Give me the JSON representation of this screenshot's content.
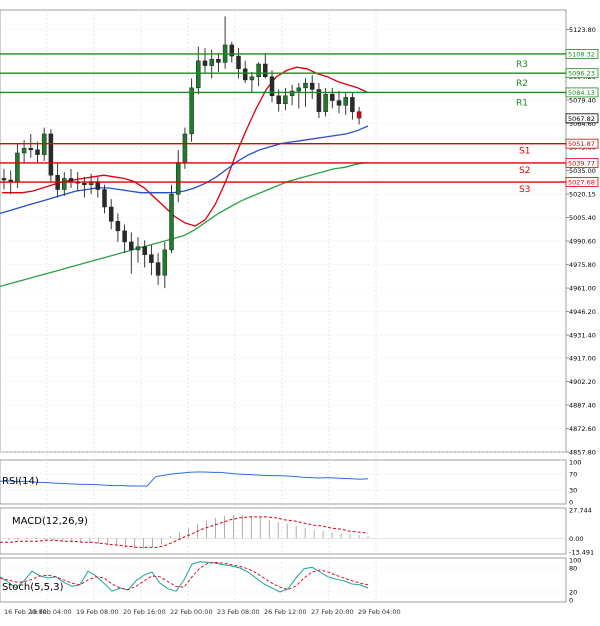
{
  "chart_data": [
    {
      "type": "candlestick",
      "panel": "price",
      "ylim": [
        4857.8,
        5136.0
      ],
      "y_ticks": [
        "5123.80",
        "5108.30",
        "5094.20",
        "5079.40",
        "5064.60",
        "5049.80",
        "5035.00",
        "5020.15",
        "5005.40",
        "4990.60",
        "4975.80",
        "4961.00",
        "4946.20",
        "4931.40",
        "4917.00",
        "4902.20",
        "4887.40",
        "4872.60",
        "4857.80"
      ],
      "x_ticks": [
        "16 Feb 20:00",
        "16 Feb 04:00",
        "19 Feb 08:00",
        "20 Feb 16:00",
        "22 Feb 00:00",
        "23 Feb 08:00",
        "26 Feb 12:00",
        "27 Feb 20:00",
        "29 Feb 04:00"
      ],
      "candles": [
        [
          5030,
          5036,
          5023,
          5029
        ],
        [
          5029,
          5035,
          5020,
          5028
        ],
        [
          5028,
          5052,
          5024,
          5046
        ],
        [
          5046,
          5054,
          5040,
          5049
        ],
        [
          5049,
          5058,
          5043,
          5048
        ],
        [
          5048,
          5053,
          5040,
          5045
        ],
        [
          5045,
          5062,
          5041,
          5058
        ],
        [
          5058,
          5061,
          5028,
          5032
        ],
        [
          5032,
          5040,
          5018,
          5023
        ],
        [
          5023,
          5034,
          5019,
          5030
        ],
        [
          5030,
          5036,
          5024,
          5028
        ],
        [
          5028,
          5034,
          5022,
          5027
        ],
        [
          5027,
          5031,
          5018,
          5026
        ],
        [
          5026,
          5033,
          5020,
          5028
        ],
        [
          5028,
          5031,
          5018,
          5023
        ],
        [
          5023,
          5026,
          5008,
          5012
        ],
        [
          5012,
          5017,
          4998,
          5003
        ],
        [
          5003,
          5008,
          4990,
          4997
        ],
        [
          4997,
          5001,
          4983,
          4990
        ],
        [
          4990,
          4996,
          4970,
          4985
        ],
        [
          4985,
          4993,
          4977,
          4987
        ],
        [
          4987,
          4991,
          4974,
          4982
        ],
        [
          4982,
          4988,
          4969,
          4977
        ],
        [
          4977,
          4983,
          4963,
          4969
        ],
        [
          4969,
          4990,
          4961,
          4985
        ],
        [
          4985,
          5026,
          4983,
          5020
        ],
        [
          5020,
          5048,
          5015,
          5040
        ],
        [
          5040,
          5062,
          5036,
          5058
        ],
        [
          5058,
          5093,
          5053,
          5087
        ],
        [
          5087,
          5113,
          5083,
          5104
        ],
        [
          5104,
          5112,
          5096,
          5101
        ],
        [
          5101,
          5111,
          5093,
          5105
        ],
        [
          5105,
          5109,
          5097,
          5103
        ],
        [
          5103,
          5132,
          5099,
          5114
        ],
        [
          5114,
          5116,
          5103,
          5107
        ],
        [
          5107,
          5112,
          5093,
          5099
        ],
        [
          5099,
          5104,
          5090,
          5092
        ],
        [
          5092,
          5097,
          5084,
          5094
        ],
        [
          5094,
          5103,
          5088,
          5102
        ],
        [
          5102,
          5109,
          5093,
          5094
        ],
        [
          5094,
          5098,
          5078,
          5082
        ],
        [
          5082,
          5086,
          5072,
          5077
        ],
        [
          5077,
          5087,
          5073,
          5082
        ],
        [
          5082,
          5089,
          5076,
          5085
        ],
        [
          5085,
          5090,
          5074,
          5087
        ],
        [
          5087,
          5093,
          5075,
          5090
        ],
        [
          5090,
          5095,
          5080,
          5086
        ],
        [
          5086,
          5090,
          5068,
          5072
        ],
        [
          5072,
          5087,
          5069,
          5083
        ],
        [
          5083,
          5087,
          5074,
          5079
        ],
        [
          5079,
          5085,
          5071,
          5076
        ],
        [
          5076,
          5084,
          5070,
          5081
        ],
        [
          5081,
          5084,
          5067,
          5072
        ],
        [
          5072,
          5075,
          5064,
          5068
        ]
      ],
      "moving_averages": [
        {
          "color": "#d9000d",
          "values": [
            5021,
            5021,
            5021,
            5022,
            5024,
            5026,
            5028,
            5029,
            5030,
            5031,
            5032,
            5031,
            5030,
            5028,
            5024,
            5018,
            5012,
            5006,
            5002,
            5000,
            5004,
            5014,
            5028,
            5045,
            5060,
            5074,
            5086,
            5094,
            5098,
            5100,
            5099,
            5096,
            5094,
            5091,
            5089,
            5087,
            5084
          ]
        },
        {
          "color": "#2450c8",
          "values": [
            5008,
            5010,
            5012,
            5014,
            5016,
            5018,
            5020,
            5022,
            5023,
            5024,
            5024,
            5023,
            5022,
            5021,
            5021,
            5021,
            5021,
            5022,
            5024,
            5027,
            5031,
            5036,
            5041,
            5045,
            5048,
            5050,
            5052,
            5053,
            5054,
            5055,
            5056,
            5057,
            5058,
            5060,
            5063
          ]
        },
        {
          "color": "#2aa044",
          "values": [
            4962,
            4964,
            4966,
            4968,
            4970,
            4972,
            4974,
            4976,
            4978,
            4980,
            4982,
            4984,
            4986,
            4988,
            4990,
            4992,
            4994,
            4998,
            5003,
            5008,
            5012,
            5016,
            5019,
            5022,
            5025,
            5028,
            5030,
            5032,
            5034,
            5036,
            5037,
            5039,
            5040
          ]
        }
      ],
      "levels": [
        {
          "name": "R3",
          "value": "5108.32",
          "color": "#1f8a1f"
        },
        {
          "name": "R2",
          "value": "5096.23",
          "color": "#1f8a1f"
        },
        {
          "name": "R1",
          "value": "5084.13",
          "color": "#1f8a1f"
        },
        {
          "name": "S1",
          "value": "5051.87",
          "color": "#e00000"
        },
        {
          "name": "S2",
          "value": "5039.77",
          "color": "#e00000"
        },
        {
          "name": "S3",
          "value": "5027.68",
          "color": "#e00000"
        }
      ],
      "current_price": "5067.82"
    },
    {
      "type": "line",
      "panel": "rsi",
      "title": "RSI(14)",
      "ylim": [
        0,
        100
      ],
      "y_ticks": [
        "100",
        "70",
        "30",
        "0"
      ],
      "values": [
        52,
        53,
        51,
        52,
        50,
        49,
        48,
        47,
        46,
        45,
        44,
        44,
        43,
        42,
        41,
        41,
        40,
        40,
        40,
        63,
        67,
        70,
        72,
        74,
        75,
        75,
        74,
        74,
        72,
        70,
        69,
        68,
        67,
        66,
        66,
        65,
        64,
        62,
        61,
        60,
        61,
        60,
        59,
        58,
        57,
        58
      ]
    },
    {
      "type": "line",
      "panel": "macd",
      "title": "MACD(12,26,9)",
      "ylim": [
        -13.491,
        27.744
      ],
      "y_ticks": [
        "27.744",
        "0.00",
        "-13.491"
      ],
      "histogram": [
        -3,
        -2,
        -2,
        -1,
        -1,
        -1,
        -2,
        -3,
        -4,
        -4,
        -5,
        -6,
        -7,
        -8,
        -9,
        -10,
        -10,
        -9,
        -6,
        2,
        6,
        10,
        14,
        17,
        20,
        22,
        23,
        23,
        22,
        20,
        18,
        16,
        14,
        12,
        10,
        8,
        7,
        6,
        5,
        4,
        3,
        2
      ],
      "signal": [
        -4,
        -4,
        -3,
        -3,
        -3,
        -2,
        -2,
        -3,
        -3,
        -4,
        -4,
        -5,
        -6,
        -7,
        -8,
        -9,
        -9,
        -9,
        -7,
        -3,
        1,
        5,
        9,
        12,
        15,
        18,
        20,
        21,
        21,
        21,
        20,
        18,
        17,
        15,
        13,
        12,
        10,
        9,
        7,
        6,
        5
      ]
    },
    {
      "type": "line",
      "panel": "stochastic",
      "title": "Stoch(5,5,3)",
      "ylim": [
        0,
        100
      ],
      "y_ticks": [
        "100",
        "80",
        "20",
        "0"
      ],
      "k": [
        58,
        45,
        30,
        48,
        72,
        60,
        55,
        58,
        44,
        34,
        38,
        72,
        60,
        42,
        22,
        30,
        25,
        48,
        62,
        70,
        42,
        28,
        22,
        50,
        90,
        96,
        94,
        92,
        88,
        85,
        80,
        70,
        55,
        40,
        30,
        20,
        28,
        55,
        78,
        82,
        70,
        58,
        52,
        48,
        40,
        38,
        30
      ],
      "d": [
        55,
        50,
        45,
        45,
        52,
        60,
        62,
        58,
        50,
        42,
        38,
        50,
        58,
        55,
        40,
        30,
        26,
        34,
        48,
        60,
        58,
        46,
        34,
        32,
        58,
        80,
        92,
        94,
        92,
        88,
        84,
        78,
        68,
        55,
        42,
        32,
        26,
        35,
        55,
        70,
        75,
        70,
        62,
        55,
        48,
        42,
        38
      ]
    }
  ]
}
